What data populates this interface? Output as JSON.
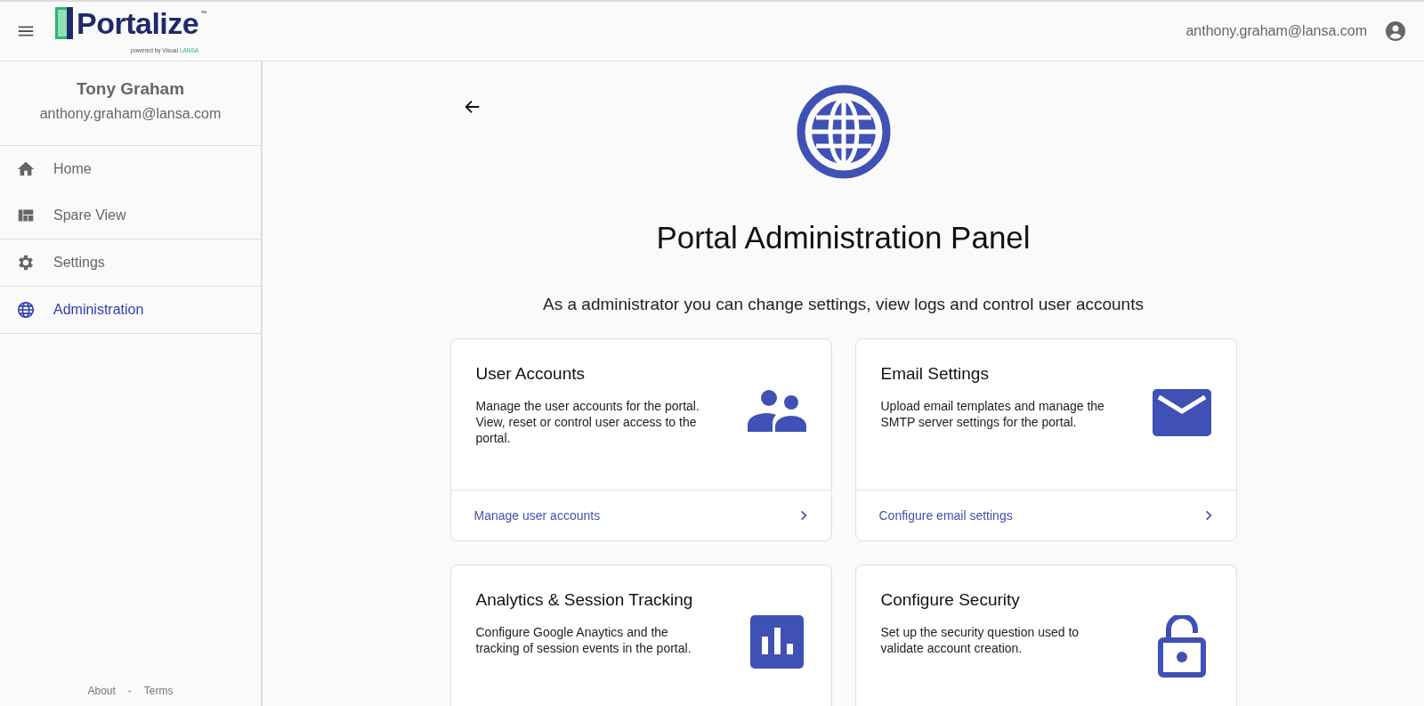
{
  "header": {
    "logo": {
      "name": "Portalize",
      "trademark": "™",
      "tagline": "powered by Visual",
      "tagline_brand": "LANSA"
    },
    "user_email": "anthony.graham@lansa.com"
  },
  "sidebar": {
    "user_name": "Tony Graham",
    "user_email": "anthony.graham@lansa.com",
    "groups": [
      [
        {
          "label": "Home",
          "kind": "home",
          "selected": false
        },
        {
          "label": "Spare View",
          "kind": "dashboard",
          "selected": false
        }
      ],
      [
        {
          "label": "Settings",
          "kind": "gear",
          "selected": false
        }
      ],
      [
        {
          "label": "Administration",
          "kind": "globe",
          "selected": true
        }
      ]
    ],
    "footer_links": [
      "About",
      "Terms"
    ],
    "footer_separator": "-"
  },
  "main": {
    "title": "Portal Administration Panel",
    "subtitle": "As a administrator you can change settings, view logs and control user accounts",
    "cards": [
      {
        "title": "User Accounts",
        "description": "Manage the user accounts for the portal. View, reset or control user access to the portal.",
        "kind": "users",
        "link": "Manage user accounts"
      },
      {
        "title": "Email Settings",
        "description": "Upload email templates and manage the SMTP server settings for the portal.",
        "kind": "mail",
        "link": "Configure email settings"
      },
      {
        "title": "Analytics & Session Tracking",
        "description": "Configure Google Anaytics and the tracking of session events in the portal.",
        "kind": "chart"
      },
      {
        "title": "Configure Security",
        "description": "Set up the security question used to validate account creation.",
        "kind": "lock"
      }
    ]
  }
}
